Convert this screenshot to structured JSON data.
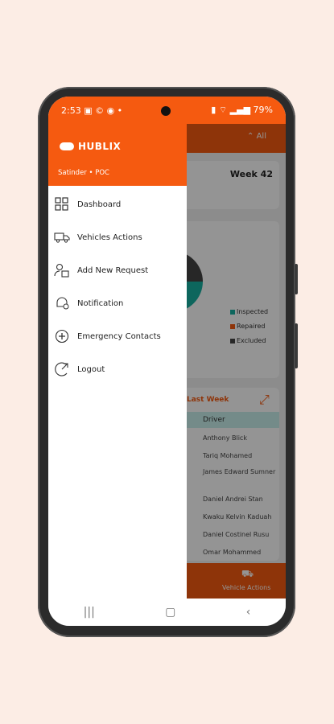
{
  "status_bar": {
    "time": "2:53",
    "icons": "▣ © ◉ •",
    "battery": "79%"
  },
  "background_app": {
    "filter_label": "All",
    "week_label": "Week 42",
    "legend": [
      {
        "label": "Inspected",
        "color": "#18b0a0"
      },
      {
        "label": "Repaired",
        "color": "#f55a10"
      },
      {
        "label": "Excluded",
        "color": "#444444"
      }
    ],
    "last_week_label": "Last Week",
    "driver_header": "Driver",
    "drivers": [
      "Anthony Blick",
      "Tariq Mohamed",
      "James Edward Sumner",
      "Daniel Andrei Stan",
      "Kwaku Kelvin Kaduah",
      "Daniel Costinel Rusu",
      "Omar Mohammed"
    ],
    "bottom_label": "Vehicle Actions"
  },
  "drawer": {
    "brand": "HUBLIX",
    "user": "Satinder • POC",
    "items": [
      {
        "label": "Dashboard",
        "icon": "dashboard-icon"
      },
      {
        "label": "Vehicles Actions",
        "icon": "truck-icon"
      },
      {
        "label": "Add New Request",
        "icon": "add-request-icon"
      },
      {
        "label": "Notification",
        "icon": "notification-icon"
      },
      {
        "label": "Emergency Contacts",
        "icon": "emergency-icon"
      },
      {
        "label": "Logout",
        "icon": "logout-icon"
      }
    ]
  },
  "navbar": {
    "recents": "|||",
    "home": "▢",
    "back": "‹"
  }
}
